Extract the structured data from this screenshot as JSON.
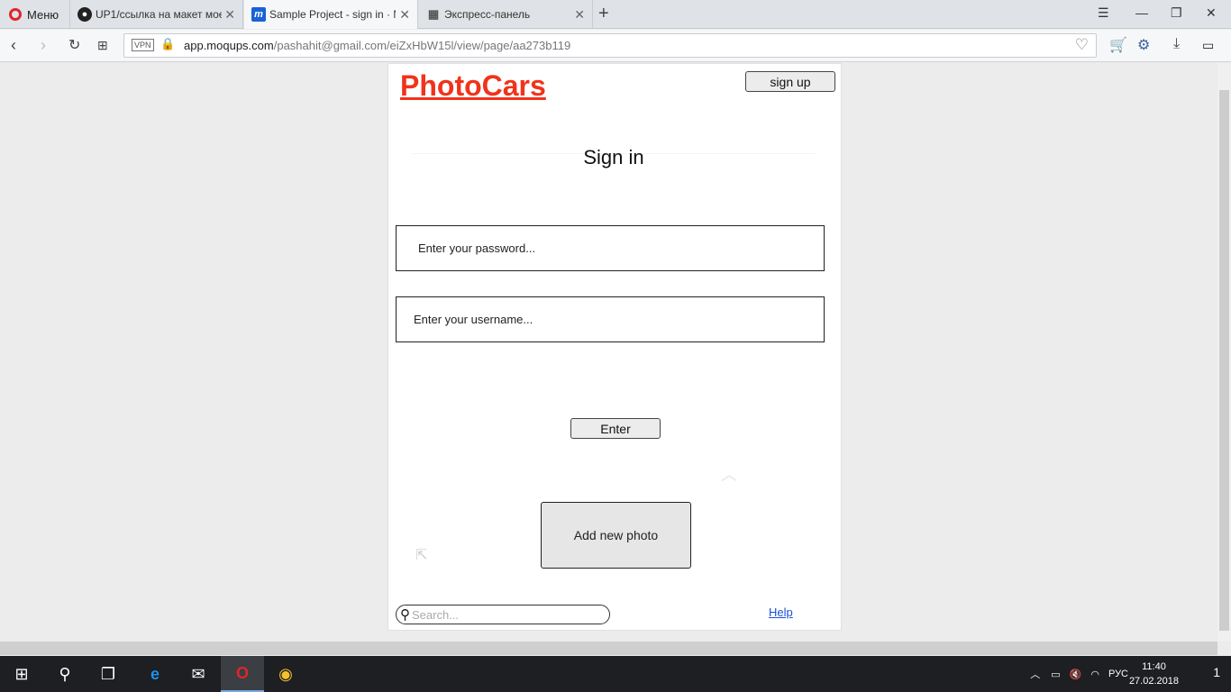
{
  "browser": {
    "menu_label": "Меню",
    "tabs": [
      {
        "label": "UP1/ссылка на макет мое",
        "icon": "github-icon"
      },
      {
        "label": "Sample Project - sign in · M",
        "icon": "moqups-icon"
      },
      {
        "label": "Экспресс-панель",
        "icon": "speed-dial-icon"
      }
    ],
    "vpn_label": "VPN",
    "url_domain": "app.moqups.com",
    "url_path": "/pashahit@gmail.com/eiZxHbW15l/view/page/aa273b119"
  },
  "mockup": {
    "logo": "PhotoCars",
    "signup_label": "sign up",
    "heading": "Sign in",
    "password_placeholder": "Enter your password...",
    "username_placeholder": "Enter your username...",
    "enter_label": "Enter",
    "add_photo_label": "Add new photo",
    "search_placeholder": "Search...",
    "help_label": "Help"
  },
  "taskbar": {
    "language": "РУС",
    "time": "11:40",
    "date": "27.02.2018",
    "notifications": "1"
  },
  "colors": {
    "logo": "#f0331b",
    "link": "#1a4fd6",
    "opera": "#e0252b"
  }
}
